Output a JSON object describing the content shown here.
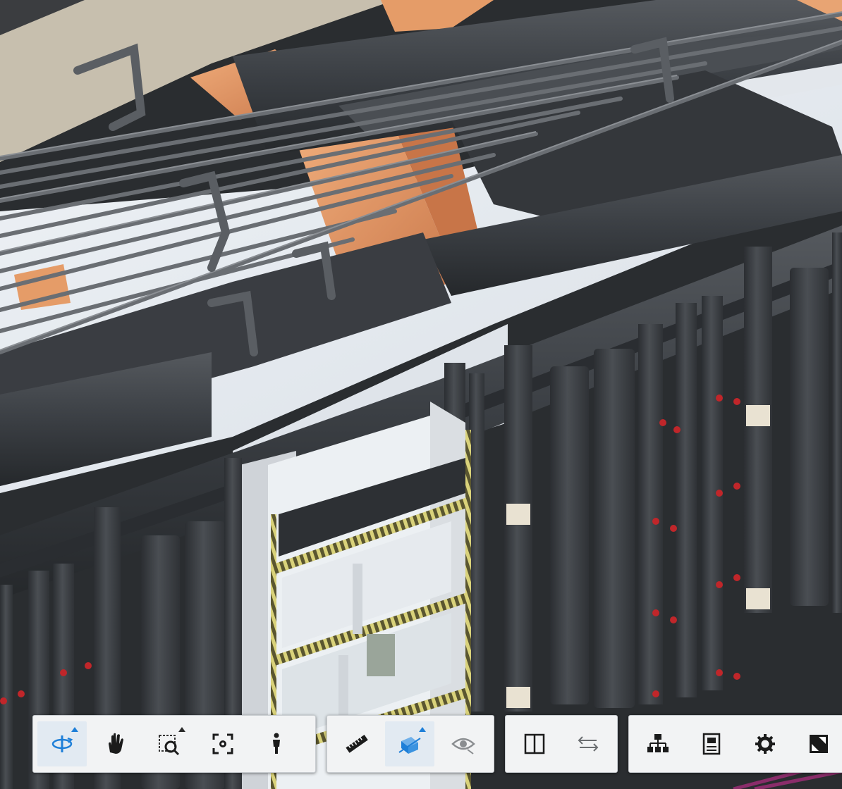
{
  "viewer": {
    "canvas": {
      "label": "3D model view"
    },
    "colors": {
      "background": "#2a2d30",
      "duct": "#3d4045",
      "duct_shade": "#2c2f33",
      "pipe": "#5d6166",
      "floor": "#e4e9ef",
      "wall": "#d2d6da",
      "orange": "#e09a66",
      "ceiling": "#c9c0b0",
      "accent_blue": "#1e7fd8"
    }
  },
  "toolbar": {
    "groups": [
      {
        "name": "navigation",
        "tools": [
          {
            "name": "orbit",
            "icon": "orbit-icon",
            "active": true,
            "flyout": true
          },
          {
            "name": "pan",
            "icon": "hand-icon",
            "active": false,
            "flyout": false
          },
          {
            "name": "zoom",
            "icon": "zoom-window-icon",
            "active": false,
            "flyout": true
          },
          {
            "name": "fit-to-view",
            "icon": "fit-view-icon",
            "active": false,
            "flyout": false
          },
          {
            "name": "first-person",
            "icon": "person-icon",
            "active": false,
            "flyout": false
          }
        ]
      },
      {
        "name": "analysis",
        "tools": [
          {
            "name": "measure",
            "icon": "ruler-icon",
            "active": false,
            "flyout": false
          },
          {
            "name": "section",
            "icon": "section-box-icon",
            "active": true,
            "flyout": true
          },
          {
            "name": "explode",
            "icon": "eye-explode-icon",
            "active": false,
            "flyout": false
          }
        ]
      },
      {
        "name": "compare",
        "tools": [
          {
            "name": "split-view",
            "icon": "split-view-icon",
            "active": false,
            "flyout": false
          },
          {
            "name": "swap",
            "icon": "swap-arrows-icon",
            "active": false,
            "flyout": false
          }
        ]
      },
      {
        "name": "settings",
        "tools": [
          {
            "name": "model-browser",
            "icon": "hierarchy-icon",
            "active": false,
            "flyout": false
          },
          {
            "name": "properties",
            "icon": "properties-icon",
            "active": false,
            "flyout": false
          },
          {
            "name": "settings",
            "icon": "gear-icon",
            "active": false,
            "flyout": false
          },
          {
            "name": "fullscreen",
            "icon": "fullscreen-icon",
            "active": false,
            "flyout": false
          }
        ]
      }
    ]
  }
}
